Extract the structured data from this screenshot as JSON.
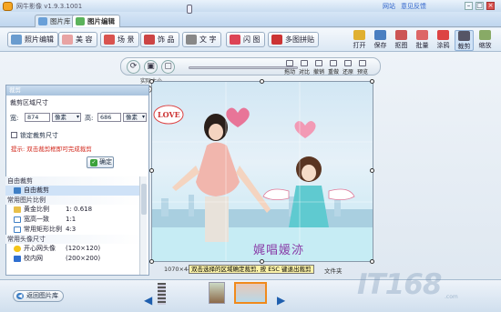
{
  "app": {
    "title": "网牛影像 v1.9.3.1001",
    "header_links": [
      "网站",
      "意见反馈"
    ],
    "window_controls": [
      "minimize-icon",
      "maximize-icon",
      "close-icon"
    ]
  },
  "tabs": [
    {
      "label": "图片库",
      "active": false,
      "icon": "gallery-icon"
    },
    {
      "label": "图片编辑",
      "active": true,
      "icon": "edit-icon"
    }
  ],
  "toolbar": {
    "left": [
      {
        "label": "照片编辑",
        "icon": "photo-edit-icon"
      },
      {
        "label": "美 容",
        "icon": "beauty-icon"
      },
      {
        "label": "场 景",
        "icon": "scene-icon"
      },
      {
        "label": "饰 品",
        "icon": "accessory-icon"
      },
      {
        "label": "文 字",
        "icon": "text-icon"
      },
      {
        "label": "闪 图",
        "icon": "flash-icon"
      },
      {
        "label": "多图拼贴",
        "icon": "collage-icon"
      }
    ],
    "right": [
      {
        "label": "打开",
        "icon": "open-icon"
      },
      {
        "label": "保存",
        "icon": "save-icon"
      },
      {
        "label": "抠图",
        "icon": "cutout-icon"
      },
      {
        "label": "批量",
        "icon": "batch-icon"
      },
      {
        "label": "涂鸦",
        "icon": "doodle-icon"
      },
      {
        "label": "裁剪",
        "icon": "crop-icon",
        "selected": true
      },
      {
        "label": "缩放",
        "icon": "resize-icon"
      }
    ]
  },
  "canvas_controls": {
    "zoom_label": "实际大小",
    "buttons": [
      "对比",
      "撤销",
      "重做",
      "还原",
      "预览"
    ],
    "extra_label": "拖动"
  },
  "crop_panel": {
    "header": "裁剪",
    "section_title": "裁剪区域尺寸",
    "width_label": "宽:",
    "width_value": "874",
    "width_unit": "像素",
    "height_label": "高:",
    "height_value": "686",
    "height_unit": "像素",
    "lock_label": "锁定裁剪尺寸",
    "hint": "提示: 双击裁剪框即可完成裁剪",
    "ok_label": "确定",
    "groups": [
      {
        "title": "自由裁剪",
        "items": [
          {
            "label": "自由裁剪",
            "ratio": "",
            "selected": true,
            "icon": "crop-icon"
          }
        ]
      },
      {
        "title": "常用图片比例",
        "items": [
          {
            "label": "黄金比例",
            "ratio": "1: 0.618",
            "selected": false,
            "icon": "ratio-icon"
          },
          {
            "label": "宽高一致",
            "ratio": "1:1",
            "selected": false,
            "icon": "ratio-icon"
          },
          {
            "label": "常用矩形比例",
            "ratio": "4:3",
            "selected": false,
            "icon": "ratio-icon"
          }
        ]
      },
      {
        "title": "常用头像尺寸",
        "items": [
          {
            "label": "开心网头像",
            "ratio": "(120×120)",
            "selected": false,
            "icon": "smile-icon"
          },
          {
            "label": "校内网",
            "ratio": "(200×200)",
            "selected": false,
            "icon": "school-icon"
          }
        ]
      }
    ]
  },
  "photo": {
    "caption": "娓唱媛洂",
    "love_text": "LOVE",
    "tooltip": "双击选择的区域确定裁剪, 按 ESC 键退出裁剪",
    "coords": "1070×448",
    "status_suffix": "文件夹"
  },
  "bottom": {
    "back_label": "返回图片库",
    "prev_icon": "prev-icon",
    "next_icon": "next-icon"
  },
  "watermark": {
    "text": "IT168",
    "sub": ".com"
  },
  "colors": {
    "accent": "#3f7fc5",
    "hint": "#d2261a",
    "selected": "#cfe2f7",
    "thumb_selected": "#f08a1c"
  }
}
